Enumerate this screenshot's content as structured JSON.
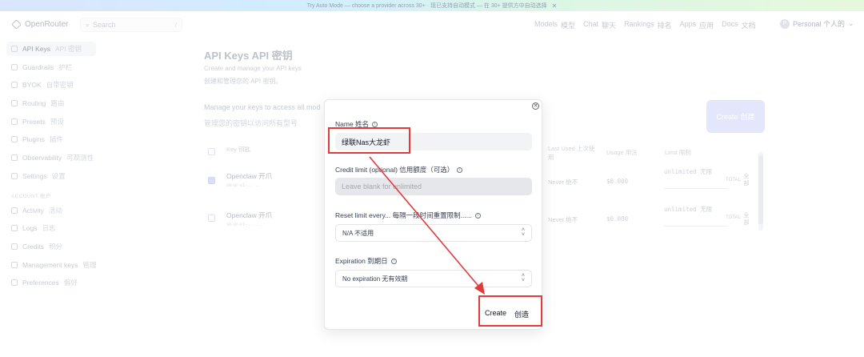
{
  "banner": {
    "text": "Try Auto Mode — choose a provider across 30+ · 现已支持自动模式 — 在 30+ 提供方中自动选择",
    "close": "✕"
  },
  "header": {
    "logo": "OpenRouter",
    "search_placeholder": "Search",
    "search_shortcut": "/",
    "nav": [
      {
        "en": "Models",
        "zh": "模型"
      },
      {
        "en": "Chat",
        "zh": "聊天"
      },
      {
        "en": "Rankings",
        "zh": "排名"
      },
      {
        "en": "Apps",
        "zh": "应用"
      },
      {
        "en": "Docs",
        "zh": "文档"
      }
    ],
    "account": {
      "initial": "P",
      "label": "Personal 个人的",
      "chevron": "⌄"
    }
  },
  "sidebar": {
    "items": [
      {
        "en": "API Keys",
        "zh": "API 密钥"
      },
      {
        "en": "Guardrails",
        "zh": "护栏"
      },
      {
        "en": "BYOK",
        "zh": "自带密钥"
      },
      {
        "en": "Routing",
        "zh": "路由"
      },
      {
        "en": "Presets",
        "zh": "预设"
      },
      {
        "en": "Plugins",
        "zh": "插件"
      },
      {
        "en": "Observability",
        "zh": "可观测性"
      },
      {
        "en": "Settings",
        "zh": "设置"
      }
    ],
    "section": "ACCOUNT 帐户",
    "account_items": [
      {
        "en": "Activity",
        "zh": "活动"
      },
      {
        "en": "Logs",
        "zh": "日志"
      },
      {
        "en": "Credits",
        "zh": "积分"
      },
      {
        "en": "Management keys",
        "zh": "管理"
      },
      {
        "en": "Preferences",
        "zh": "偏好"
      }
    ]
  },
  "main": {
    "title": "API Keys  API 密钥",
    "subtitle_en": "Create and manage your API keys",
    "subtitle_zh": "创建和管理您的 API 密钥。",
    "manage_en": "Manage your keys to access all mod",
    "manage_zh": "管理您的密钥以访问所有型号",
    "create_button": {
      "en": "Create",
      "zh": "创建"
    },
    "columns": {
      "key": "Key 钥匙",
      "last_used": "Last Used 上次使用",
      "usage": "Usage 用法",
      "limit": "Limit 限制"
    },
    "rows": [
      {
        "name": "Openclaw 开爪",
        "hint": "sk-or-v1-... · ...",
        "last_used": "Never 绝不",
        "usage": "$0.000",
        "limit": "unlimited 无限",
        "limit_type": "TOTAL",
        "checked": true
      },
      {
        "name": "Openclaw 开爪",
        "hint": "sk-or-v1-... · ...",
        "last_used": "Never 绝不",
        "usage": "$0.000",
        "limit": "unlimited 无限",
        "limit_type": "TOTAL",
        "checked": false
      }
    ],
    "row_action": "全部"
  },
  "modal": {
    "close": "✕",
    "name_label": "Name  姓名",
    "name_value": "绿联Nas大龙虾",
    "credit_label": "Credit limit (optional)  信用额度（可选）",
    "credit_placeholder": "Leave blank for unlimited",
    "reset_label": "Reset limit every...  每隔一段时间重置限制......",
    "reset_value": "N/A  不适用",
    "expiration_label": "Expiration  到期日",
    "expiration_value": "No expiration  无有效期",
    "create_en": "Create",
    "create_zh": "创造"
  },
  "colors": {
    "accent": "#6366f1",
    "highlight": "#e23b3b"
  }
}
